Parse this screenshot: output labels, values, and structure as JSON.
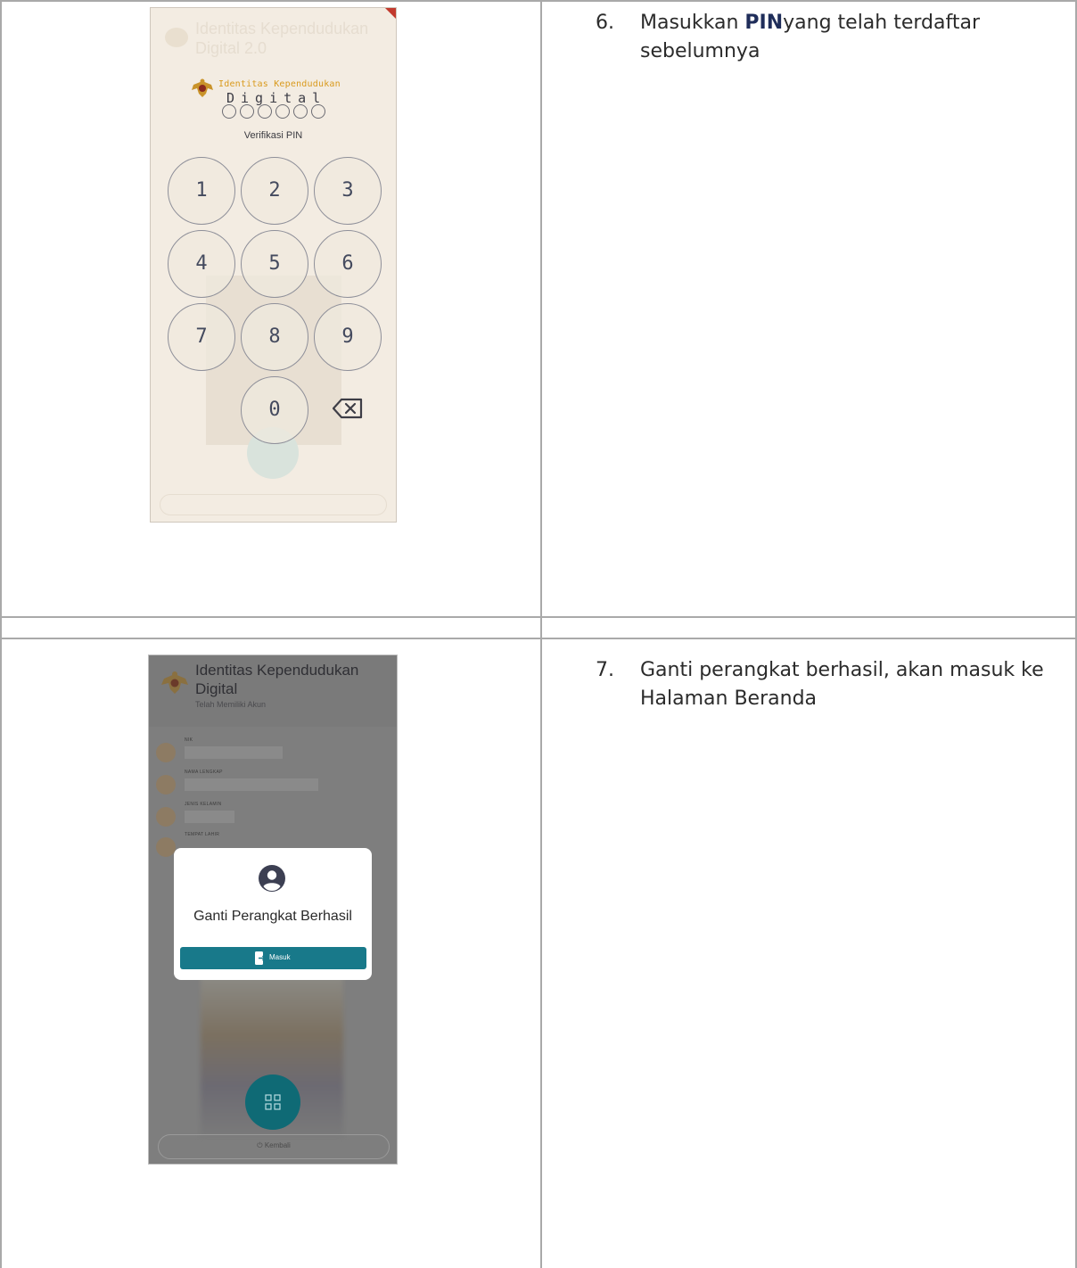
{
  "rows": [
    {
      "step_number": "6.",
      "text_before": "Masukkan ",
      "text_bold": "PIN",
      "text_after": "yang telah terdaftar sebelumnya"
    },
    {
      "step_number": "7.",
      "text": "Ganti perangkat berhasil, akan masuk ke Halaman Beranda"
    }
  ],
  "screen_pin": {
    "bg_title": "Identitas Kependudukan Digital 2.0",
    "brand_top": "Identitas Kependudukan",
    "brand_bottom": "Digital",
    "verify_label": "Verifikasi PIN",
    "keys": [
      "1",
      "2",
      "3",
      "4",
      "5",
      "6",
      "7",
      "8",
      "9",
      "0"
    ],
    "backspace_icon": "backspace-icon",
    "accent": "#d99a1d"
  },
  "screen_success": {
    "app_title": "Identitas Kependudukan Digital",
    "app_subtitle": "Telah Memiliki Akun",
    "fields": [
      {
        "label": "NIK"
      },
      {
        "label": "NAMA LENGKAP"
      },
      {
        "label": "JENIS KELAMIN"
      },
      {
        "label": "TEMPAT LAHIR"
      }
    ],
    "dialog": {
      "icon": "account-circle-icon",
      "title": "Ganti Perangkat Berhasil",
      "button_label": "Masuk",
      "button_icon": "login-icon",
      "button_color": "#18798a"
    },
    "back_label": "Kembali",
    "back_icon": "power-icon"
  }
}
